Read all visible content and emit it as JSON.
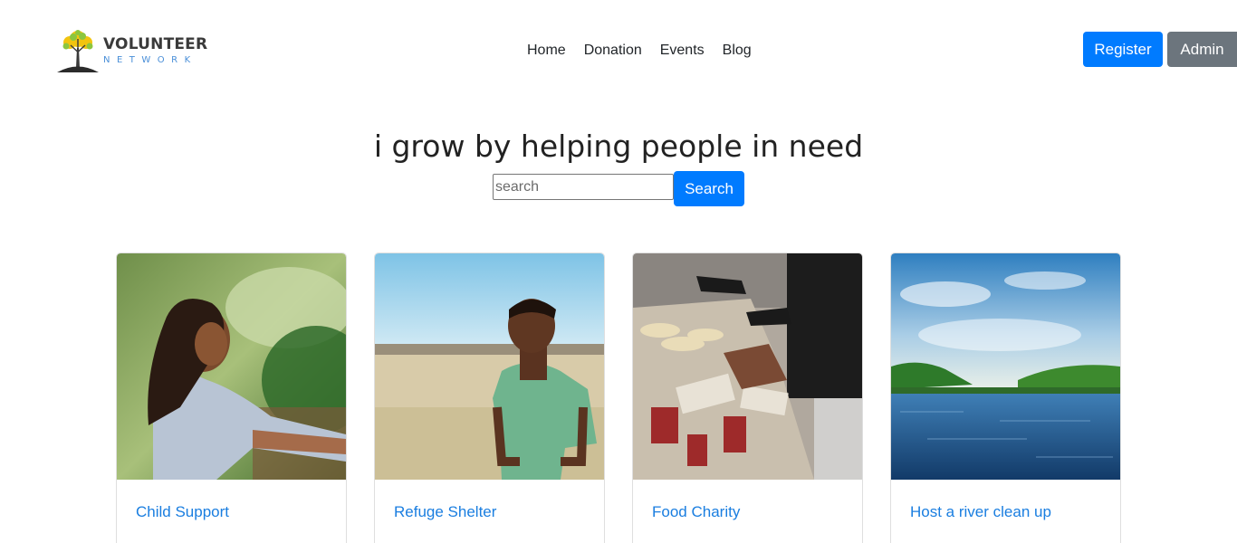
{
  "brand": {
    "title": "VOLUNTEER",
    "subtitle": "NETWORK"
  },
  "nav": {
    "items": [
      "Home",
      "Donation",
      "Events",
      "Blog"
    ]
  },
  "header_buttons": {
    "register": "Register",
    "admin": "Admin"
  },
  "hero": {
    "headline": "i grow by helping people in need",
    "search_placeholder": "search",
    "search_value": "",
    "search_button": "Search"
  },
  "cards": [
    {
      "title": "Child Support",
      "image": "girl-outdoors-photo"
    },
    {
      "title": "Refuge Shelter",
      "image": "boy-field-photo"
    },
    {
      "title": "Food Charity",
      "image": "food-distribution-photo"
    },
    {
      "title": "Host a river clean up",
      "image": "river-landscape-photo"
    }
  ],
  "colors": {
    "primary": "#007bff",
    "secondary": "#6c757d",
    "link": "#1a7ee0"
  }
}
